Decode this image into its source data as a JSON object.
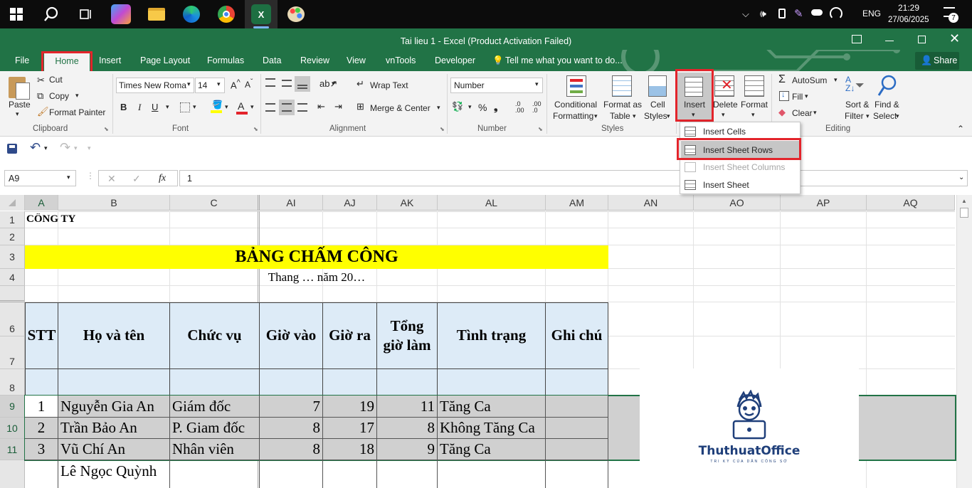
{
  "taskbar": {
    "time": "21:29",
    "date": "27/06/2025",
    "lang": "ENG",
    "notif_count": "7"
  },
  "window": {
    "title": "Tai lieu 1 - Excel (Product Activation Failed)"
  },
  "tabs": [
    {
      "label": "File"
    },
    {
      "label": "Home"
    },
    {
      "label": "Insert"
    },
    {
      "label": "Page Layout"
    },
    {
      "label": "Formulas"
    },
    {
      "label": "Data"
    },
    {
      "label": "Review"
    },
    {
      "label": "View"
    },
    {
      "label": "vnTools"
    },
    {
      "label": "Developer"
    }
  ],
  "tell_me": "Tell me what you want to do...",
  "share": "Share",
  "clipboard": {
    "paste": "Paste",
    "cut": "Cut",
    "copy": "Copy",
    "format_painter": "Format Painter",
    "label": "Clipboard"
  },
  "font": {
    "name": "Times New Roma",
    "size": "14",
    "label": "Font",
    "bold": "B",
    "italic": "I",
    "underline": "U"
  },
  "alignment": {
    "wrap": "Wrap Text",
    "merge": "Merge & Center",
    "label": "Alignment"
  },
  "number": {
    "format": "Number",
    "label": "Number"
  },
  "styles": {
    "cond1": "Conditional",
    "cond2": "Formatting",
    "fmt1": "Format as",
    "fmt2": "Table",
    "cell1": "Cell",
    "cell2": "Styles",
    "label": "Styles"
  },
  "cells": {
    "insert": "Insert",
    "delete": "Delete",
    "format": "Format"
  },
  "editing": {
    "autosum": "AutoSum",
    "fill": "Fill",
    "clear": "Clear",
    "sort1": "Sort &",
    "sort2": "Filter",
    "find1": "Find &",
    "find2": "Select",
    "label": "Editing"
  },
  "insert_menu": [
    {
      "label": "Insert Cells"
    },
    {
      "label": "Insert Sheet Rows"
    },
    {
      "label": "Insert Sheet Columns"
    },
    {
      "label": "Insert Sheet"
    }
  ],
  "namebox": "A9",
  "fx": "fx",
  "formula_value": "1",
  "columns": [
    "A",
    "B",
    "C",
    "AI",
    "AJ",
    "AK",
    "AL",
    "AM",
    "AN",
    "AO",
    "AP",
    "AQ"
  ],
  "rows": [
    "1",
    "2",
    "3",
    "4",
    "6",
    "7",
    "8",
    "9",
    "10",
    "11"
  ],
  "sheet": {
    "company": "CÔNG TY",
    "title": "BẢNG CHẤM CÔNG",
    "subtitle": "Thang … năm 20…",
    "headers": {
      "stt": "STT",
      "name": "Họ và tên",
      "position": "Chức vụ",
      "in": "Giờ vào",
      "out": "Giờ ra",
      "total1": "Tổng",
      "total2": "giờ làm",
      "status": "Tình trạng",
      "note": "Ghi chú"
    },
    "data": [
      {
        "stt": "1",
        "name": "Nguyễn Gia An",
        "position": "Giám đốc",
        "in": "7",
        "out": "19",
        "total": "11",
        "status": "Tăng Ca"
      },
      {
        "stt": "2",
        "name": "Trần Bảo An",
        "position": "P. Giam đốc",
        "in": "8",
        "out": "17",
        "total": "8",
        "status": "Không Tăng Ca"
      },
      {
        "stt": "3",
        "name": "Vũ Chí An",
        "position": "Nhân viên",
        "in": "8",
        "out": "18",
        "total": "9",
        "status": "Tăng Ca"
      }
    ],
    "partial_name": "Lê Ngọc Quỳnh"
  },
  "watermark": {
    "brand": "ThuthuatOffice",
    "tagline": "TRI KỲ CỦA DÂN CÔNG SỞ"
  },
  "colors": {
    "excel_green": "#217346",
    "header_fill": "#ddebf7",
    "title_fill": "#ffff00",
    "selection": "#d0d0d0",
    "highlight": "#e3242b"
  }
}
